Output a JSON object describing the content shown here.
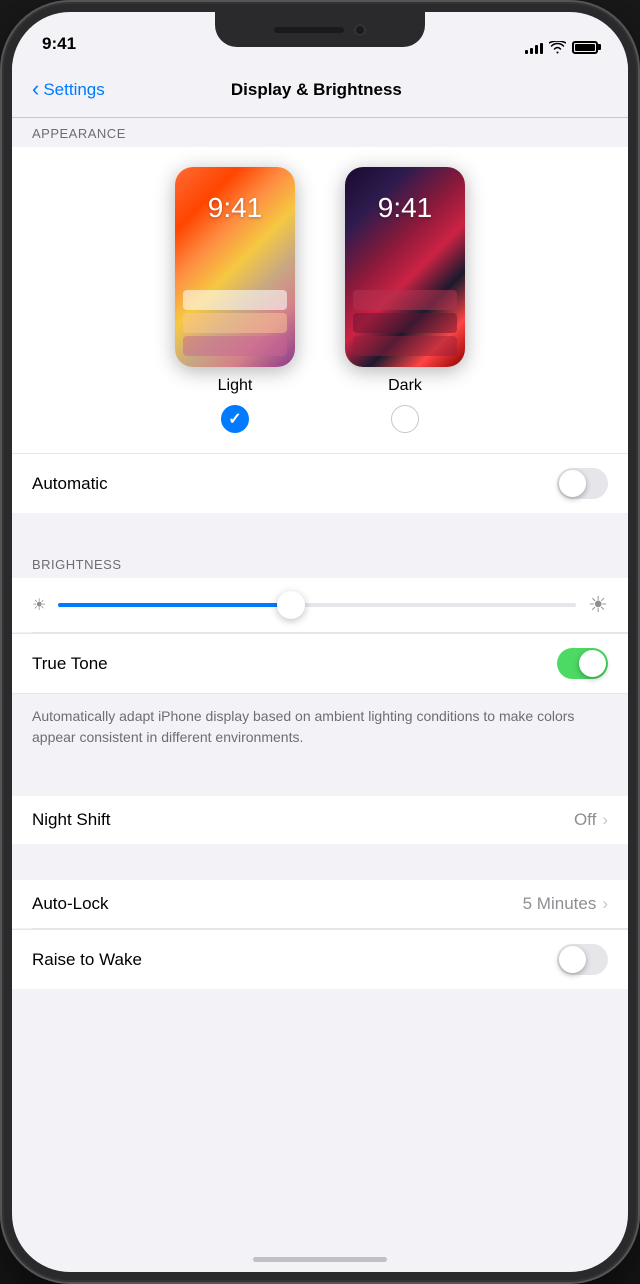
{
  "status": {
    "time": "9:41",
    "signal_bars": [
      4,
      6,
      9,
      11,
      14
    ],
    "battery_percent": 100
  },
  "navigation": {
    "back_label": "Settings",
    "title": "Display & Brightness"
  },
  "appearance": {
    "section_header": "APPEARANCE",
    "light_label": "Light",
    "dark_label": "Dark",
    "light_time": "9:41",
    "dark_time": "9:41",
    "light_selected": true,
    "automatic_label": "Automatic",
    "automatic_on": false
  },
  "brightness": {
    "section_header": "BRIGHTNESS",
    "slider_value": 45,
    "true_tone_label": "True Tone",
    "true_tone_on": true,
    "true_tone_description": "Automatically adapt iPhone display based on ambient lighting conditions to make colors appear consistent in different environments."
  },
  "night_shift": {
    "label": "Night Shift",
    "value": "Off"
  },
  "auto_lock": {
    "label": "Auto-Lock",
    "value": "5 Minutes"
  },
  "raise_to_wake": {
    "label": "Raise to Wake",
    "on": false
  }
}
